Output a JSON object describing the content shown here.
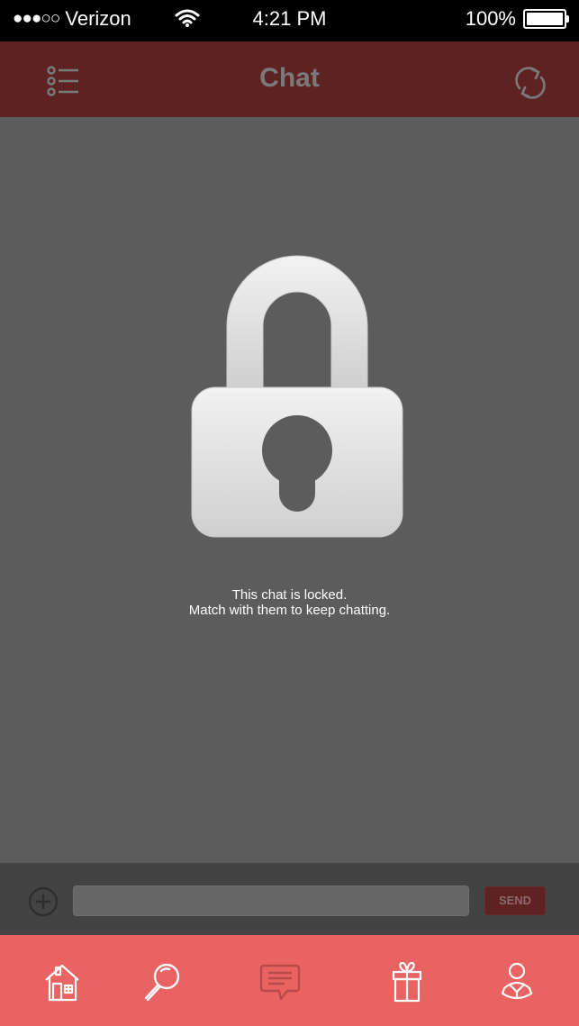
{
  "status_bar": {
    "carrier": "Verizon",
    "signal_dots": "●●●○○",
    "time": "4:21 PM",
    "battery": "100%",
    "battery_level": 1.0
  },
  "header": {
    "title": "Chat",
    "menu_icon": "list-menu-icon",
    "refresh_icon": "refresh-icon"
  },
  "locked": {
    "icon": "padlock-icon",
    "line1": "This chat is locked.",
    "line2": "Match with them to keep chatting."
  },
  "compose": {
    "add_icon": "plus-circle-icon",
    "input_value": "",
    "input_placeholder": "",
    "send_label": "SEND"
  },
  "tabs": [
    {
      "icon": "home-icon",
      "name": "home"
    },
    {
      "icon": "search-icon",
      "name": "search"
    },
    {
      "icon": "chat-icon",
      "name": "chat"
    },
    {
      "icon": "gift-icon",
      "name": "gifts"
    },
    {
      "icon": "profile-icon",
      "name": "profile"
    }
  ],
  "colors": {
    "header_bg": "#5e2223",
    "tabbar_bg": "#e96363",
    "content_bg": "#5c5c5c"
  }
}
